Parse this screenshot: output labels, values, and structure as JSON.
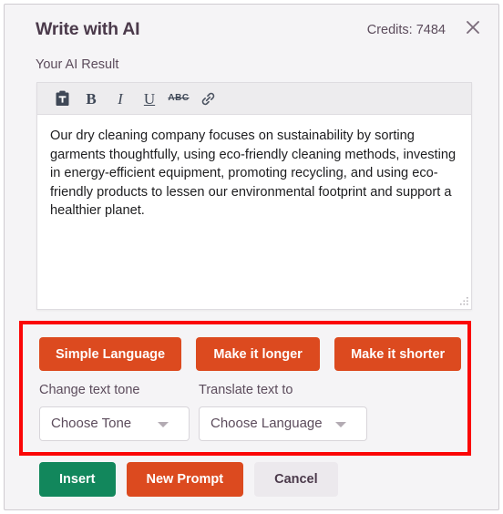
{
  "dialog": {
    "title": "Write with AI",
    "credits_label": "Credits: 7484",
    "close_icon": "close-icon"
  },
  "editor": {
    "label": "Your AI Result",
    "toolbar": [
      {
        "name": "paste-icon",
        "label": ""
      },
      {
        "name": "bold-icon",
        "label": "B"
      },
      {
        "name": "italic-icon",
        "label": "I"
      },
      {
        "name": "underline-icon",
        "label": "U"
      },
      {
        "name": "strikethrough-icon",
        "label": "ABC"
      },
      {
        "name": "link-icon",
        "label": ""
      }
    ],
    "content": "Our dry cleaning company focuses on sustainability by sorting garments thoughtfully, using eco-friendly cleaning methods, investing in energy-efficient equipment, promoting recycling, and using eco-friendly products to lessen our environmental footprint and support a healthier planet.",
    "resize_grip": "resize-handle"
  },
  "actions": {
    "simple_language": "Simple Language",
    "make_longer": "Make it longer",
    "make_shorter": "Make it shorter"
  },
  "selects": {
    "tone_label": "Change text tone",
    "tone_value": "Choose Tone",
    "translate_label": "Translate text to",
    "translate_value": "Choose Language"
  },
  "footer": {
    "insert": "Insert",
    "new_prompt": "New Prompt",
    "cancel": "Cancel"
  },
  "colors": {
    "orange": "#dc4a1f",
    "green": "#12875c",
    "gray_button": "#ece9ed",
    "highlight_red": "#fb0606",
    "dialog_bg": "#f5f4f6",
    "text_dark": "#4b3a4b"
  }
}
